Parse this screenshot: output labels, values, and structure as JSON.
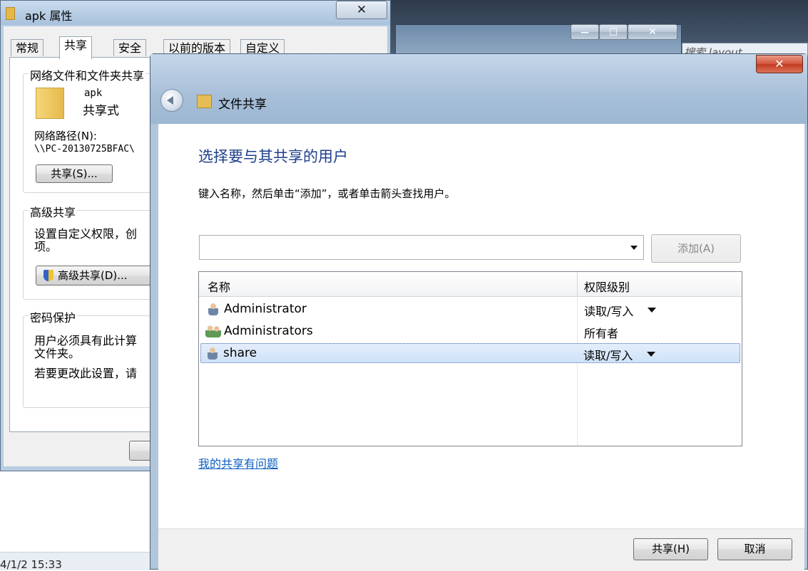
{
  "props_window": {
    "title": "apk 属性",
    "close_glyph": "✕",
    "tabs": [
      "常规",
      "共享",
      "安全",
      "以前的版本",
      "自定义"
    ],
    "active_tab": "共享",
    "network_group": {
      "title": "网络文件和文件夹共享",
      "folder_name": "apk",
      "share_state": "共享式",
      "path_label": "网络路径(N):",
      "path_value": "\\\\PC-20130725BFAC\\",
      "share_button": "共享(S)..."
    },
    "advanced_group": {
      "title": "高级共享",
      "desc": "设置自定义权限，创",
      "desc2": "项。",
      "button": "高级共享(D)..."
    },
    "password_group": {
      "title": "密码保护",
      "desc": "用户必须具有此计算",
      "desc2": "文件夹。",
      "desc3": "若要更改此设置，请"
    }
  },
  "back_window": {
    "search_text": "搜索 layout",
    "minimize_glyph": "—",
    "maximize_glyph": "□",
    "close_glyph": "✕"
  },
  "taskbar": {
    "datetime": "4/1/2 15:33"
  },
  "share_dialog": {
    "title": "文件共享",
    "close_glyph": "✕",
    "heading": "选择要与其共享的用户",
    "instruction": "键入名称，然后单击“添加”，或者单击箭头查找用户。",
    "combo_value": "",
    "add_button": "添加(A)",
    "columns": {
      "name": "名称",
      "permission": "权限级别"
    },
    "rows": [
      {
        "name": "Administrator",
        "permission": "读取/写入",
        "has_dropdown": true
      },
      {
        "name": "Administrators",
        "permission": "所有者",
        "has_dropdown": false
      },
      {
        "name": "share",
        "permission": "读取/写入",
        "has_dropdown": true
      }
    ],
    "selected_row": "share",
    "help_link": "我的共享有问题",
    "share_button": "共享(H)",
    "cancel_button": "取消"
  }
}
